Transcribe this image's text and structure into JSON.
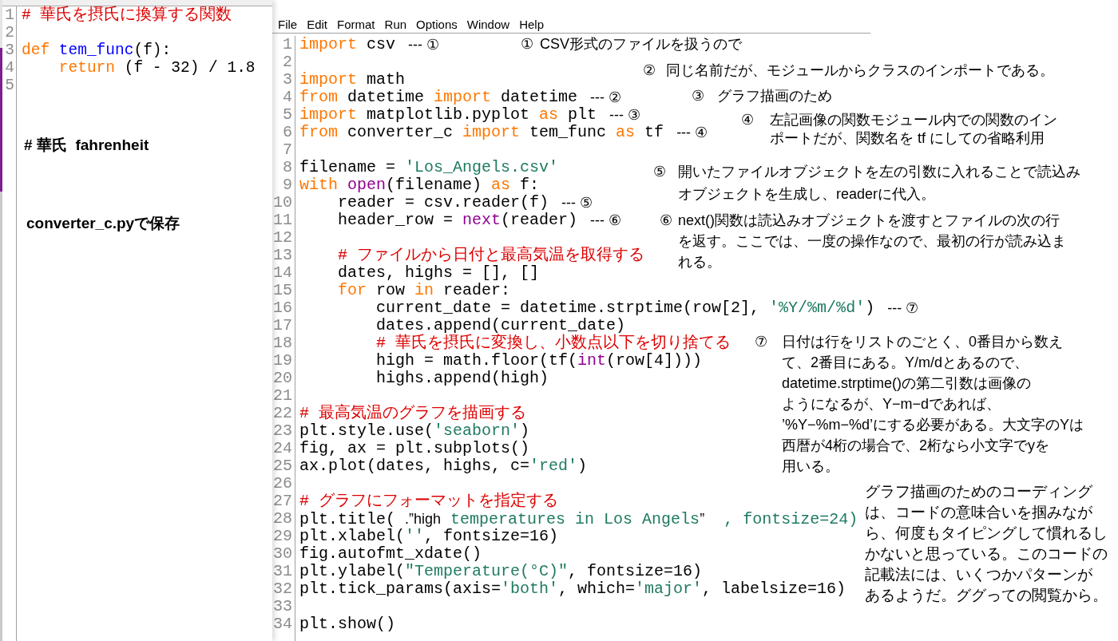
{
  "left_editor": {
    "lines": [
      {
        "number": "1",
        "tokens": [
          {
            "text": "# 華氏を摂氏に換算する関数",
            "kind": "comment"
          }
        ]
      },
      {
        "number": "2"
      },
      {
        "number": "3",
        "tokens": [
          {
            "text": "def ",
            "kind": "keyword"
          },
          {
            "text": "tem_func",
            "kind": "defname"
          },
          {
            "text": "(f):",
            "kind": "plain"
          }
        ]
      },
      {
        "number": "4",
        "tokens": [
          {
            "text": "    return",
            "kind": "keyword"
          },
          {
            "text": " (f - 32) / 1.8",
            "kind": "plain"
          }
        ]
      },
      {
        "number": "5"
      }
    ]
  },
  "left_notes": [
    "# 華氏  fahrenheit",
    "converter_c.pyで保存"
  ],
  "menu": [
    "File",
    "Edit",
    "Format",
    "Run",
    "Options",
    "Window",
    "Help"
  ],
  "editor": {
    "lines": [
      {
        "number": "1",
        "tokens": [
          {
            "text": "import",
            "kind": "keyword"
          },
          {
            "text": " csv",
            "kind": "plain"
          }
        ],
        "marker": "--- ①"
      },
      {
        "number": "2"
      },
      {
        "number": "3",
        "tokens": [
          {
            "text": "import",
            "kind": "keyword"
          },
          {
            "text": " math",
            "kind": "plain"
          }
        ]
      },
      {
        "number": "4",
        "tokens": [
          {
            "text": "from",
            "kind": "keyword"
          },
          {
            "text": " datetime ",
            "kind": "plain"
          },
          {
            "text": "import",
            "kind": "keyword"
          },
          {
            "text": " datetime",
            "kind": "plain"
          }
        ],
        "marker": "--- ②"
      },
      {
        "number": "5",
        "tokens": [
          {
            "text": "import",
            "kind": "keyword"
          },
          {
            "text": " matplotlib.pyplot ",
            "kind": "plain"
          },
          {
            "text": "as",
            "kind": "keyword"
          },
          {
            "text": " plt",
            "kind": "plain"
          }
        ],
        "marker": "--- ③"
      },
      {
        "number": "6",
        "tokens": [
          {
            "text": "from",
            "kind": "keyword"
          },
          {
            "text": " converter_c ",
            "kind": "plain"
          },
          {
            "text": "import",
            "kind": "keyword"
          },
          {
            "text": " tem_func ",
            "kind": "plain"
          },
          {
            "text": "as",
            "kind": "keyword"
          },
          {
            "text": " tf",
            "kind": "plain"
          }
        ],
        "marker": "--- ④"
      },
      {
        "number": "7"
      },
      {
        "number": "8",
        "tokens": [
          {
            "text": "filename = ",
            "kind": "plain"
          },
          {
            "text": "'Los_Angels.csv'",
            "kind": "string"
          }
        ]
      },
      {
        "number": "9",
        "tokens": [
          {
            "text": "with ",
            "kind": "keyword"
          },
          {
            "text": "open",
            "kind": "builtin"
          },
          {
            "text": "(filename) ",
            "kind": "plain"
          },
          {
            "text": "as",
            "kind": "keyword"
          },
          {
            "text": " f:",
            "kind": "plain"
          }
        ]
      },
      {
        "number": "10",
        "tokens": [
          {
            "text": "    reader = csv.reader(f)",
            "kind": "plain"
          }
        ],
        "marker": "--- ⑤"
      },
      {
        "number": "11",
        "tokens": [
          {
            "text": "    header_row = ",
            "kind": "plain"
          },
          {
            "text": "next",
            "kind": "builtin"
          },
          {
            "text": "(reader)",
            "kind": "plain"
          }
        ],
        "marker": "--- ⑥"
      },
      {
        "number": "12"
      },
      {
        "number": "13",
        "tokens": [
          {
            "text": "    # ファイルから日付と最高気温を取得する",
            "kind": "comment"
          }
        ]
      },
      {
        "number": "14",
        "tokens": [
          {
            "text": "    dates, highs = [], []",
            "kind": "plain"
          }
        ]
      },
      {
        "number": "15",
        "tokens": [
          {
            "text": "    for",
            "kind": "keyword"
          },
          {
            "text": " row ",
            "kind": "plain"
          },
          {
            "text": "in",
            "kind": "keyword"
          },
          {
            "text": " reader:",
            "kind": "plain"
          }
        ]
      },
      {
        "number": "16",
        "tokens": [
          {
            "text": "        current_date = datetime.strptime(row[2], ",
            "kind": "plain"
          },
          {
            "text": "'%Y/%m/%d'",
            "kind": "string"
          },
          {
            "text": ")",
            "kind": "plain"
          }
        ],
        "marker": "--- ⑦"
      },
      {
        "number": "17",
        "tokens": [
          {
            "text": "        dates.append(current_date)",
            "kind": "plain"
          }
        ]
      },
      {
        "number": "18",
        "tokens": [
          {
            "text": "        # 華氏を摂氏に変換し、小数点以下を切り捨てる",
            "kind": "comment"
          }
        ]
      },
      {
        "number": "19",
        "tokens": [
          {
            "text": "        high = math.floor(tf(",
            "kind": "plain"
          },
          {
            "text": "int",
            "kind": "builtin"
          },
          {
            "text": "(row[4])))",
            "kind": "plain"
          }
        ]
      },
      {
        "number": "20",
        "tokens": [
          {
            "text": "        highs.append(high)",
            "kind": "plain"
          }
        ]
      },
      {
        "number": "21"
      },
      {
        "number": "22",
        "tokens": [
          {
            "text": "# 最高気温のグラフを描画する",
            "kind": "comment"
          }
        ]
      },
      {
        "number": "23",
        "tokens": [
          {
            "text": "plt.style.use(",
            "kind": "plain"
          },
          {
            "text": "'seaborn'",
            "kind": "string"
          },
          {
            "text": ")",
            "kind": "plain"
          }
        ]
      },
      {
        "number": "24",
        "tokens": [
          {
            "text": "fig, ax = plt.subplots()",
            "kind": "plain"
          }
        ]
      },
      {
        "number": "25",
        "tokens": [
          {
            "text": "ax.plot(dates, highs, c=",
            "kind": "plain"
          },
          {
            "text": "'red'",
            "kind": "string"
          },
          {
            "text": ")",
            "kind": "plain"
          }
        ]
      },
      {
        "number": "26"
      },
      {
        "number": "27",
        "tokens": [
          {
            "text": "# グラフにフォーマットを指定する",
            "kind": "comment"
          }
        ]
      },
      {
        "number": "28",
        "tokens": [
          {
            "text": "plt.title( ",
            "kind": "plain"
          },
          {
            "text": ".”high",
            "kind": "prose"
          },
          {
            "text": " temperatures in Los Angels",
            "kind": "string"
          },
          {
            "text": "”",
            "kind": "prose"
          },
          {
            "text": "  , fontsize=24)",
            "kind": "string"
          }
        ]
      },
      {
        "number": "29",
        "tokens": [
          {
            "text": "plt.xlabel(",
            "kind": "plain"
          },
          {
            "text": "''",
            "kind": "string"
          },
          {
            "text": ", fontsize=16)",
            "kind": "plain"
          }
        ]
      },
      {
        "number": "30",
        "tokens": [
          {
            "text": "fig.autofmt_xdate()",
            "kind": "plain"
          }
        ]
      },
      {
        "number": "31",
        "tokens": [
          {
            "text": "plt.ylabel(",
            "kind": "plain"
          },
          {
            "text": "\"Temperature(°C)\"",
            "kind": "string"
          },
          {
            "text": ", fontsize=16)",
            "kind": "plain"
          }
        ]
      },
      {
        "number": "32",
        "tokens": [
          {
            "text": "plt.tick_params(axis=",
            "kind": "plain"
          },
          {
            "text": "'both'",
            "kind": "string"
          },
          {
            "text": ", which=",
            "kind": "plain"
          },
          {
            "text": "'major'",
            "kind": "string"
          },
          {
            "text": ", labelsize=16)",
            "kind": "plain"
          }
        ]
      },
      {
        "number": "33"
      },
      {
        "number": "34",
        "tokens": [
          {
            "text": "plt.show()",
            "kind": "plain"
          }
        ]
      }
    ]
  },
  "annotations": [
    {
      "marker": "①",
      "lines": [
        "CSV形式のファイルを扱うので"
      ]
    },
    {
      "marker": "②",
      "lines": [
        "同じ名前だが、モジュールからクラスのインポートである。"
      ]
    },
    {
      "marker": "③",
      "lines": [
        "グラフ描画のため"
      ]
    },
    {
      "marker": "④",
      "lines": [
        "左記画像の関数モジュール内での関数のイン",
        "ポートだが、関数名を tf にしての省略利用"
      ]
    },
    {
      "marker": "⑤",
      "lines": [
        "開いたファイルオブジェクトを左の引数に入れることで読込み",
        "オブジェクトを生成し、readerに代入。"
      ]
    },
    {
      "marker": "⑥",
      "lines": [
        "next()関数は読込みオブジェクトを渡すとファイルの次の行",
        "を返す。ここでは、一度の操作なので、最初の行が読み込ま",
        "れる。"
      ]
    },
    {
      "marker": "⑦",
      "lines": [
        "日付は行をリストのごとく、0番目から数え",
        "て、2番目にある。Y/m/dとあるので、",
        "datetime.strptime()の第二引数は画像の",
        "ようになるが、Y−m−dであれば、",
        "’%Y−%m−%d’にする必要がある。大文字のYは",
        "西暦が4桁の場合で、2桁なら小文字でyを",
        "用いる。"
      ]
    }
  ],
  "closing_note": {
    "lines": [
      "グラフ描画のためのコーディング",
      "は、コードの意味合いを掴みなが",
      "ら、何度もタイピングして慣れるし",
      "かないと思っている。このコードの",
      "記載法には、いくつかパターンが",
      "あるようだ。ググっての閲覧から。"
    ]
  }
}
